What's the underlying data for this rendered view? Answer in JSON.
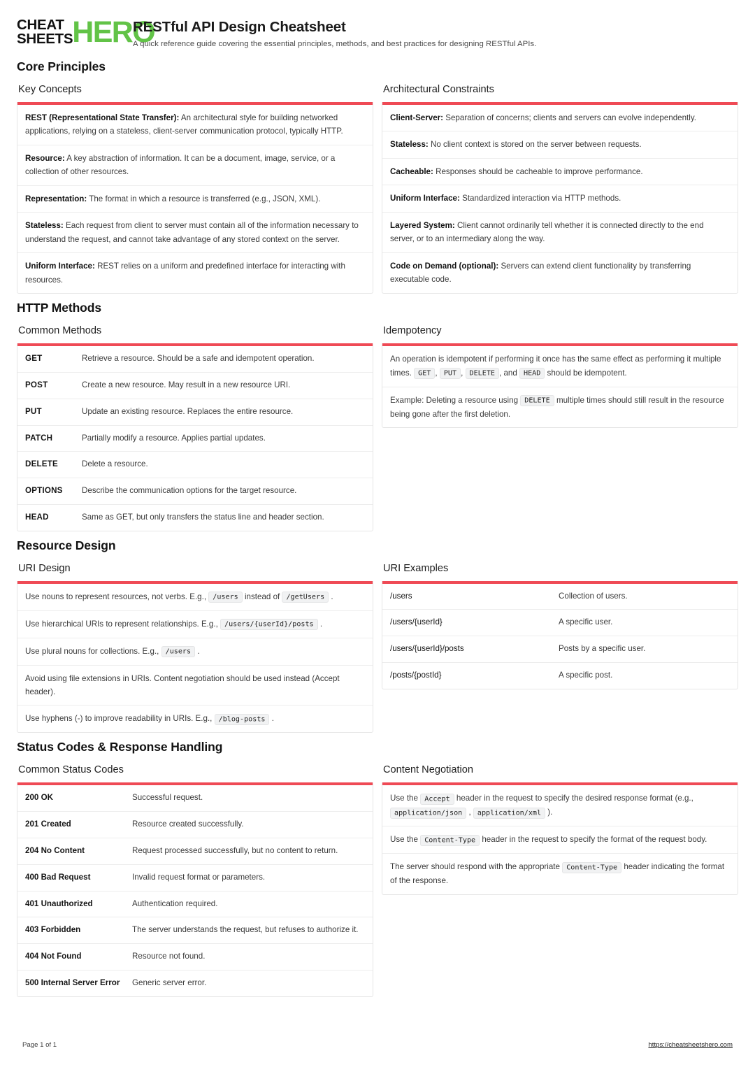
{
  "brand": {
    "line1": "CHEAT",
    "line2": "SHEETS",
    "hero": "HERO",
    "hero_color": "#62c347"
  },
  "header": {
    "title": "RESTful API Design Cheatsheet",
    "subtitle": "A quick reference guide covering the essential principles, methods, and best practices for designing RESTful APIs."
  },
  "accent_color": "#ef4a55",
  "sections": [
    {
      "title": "Core Principles"
    },
    {
      "title": "HTTP Methods"
    },
    {
      "title": "Resource Design"
    },
    {
      "title": "Status Codes & Response Handling"
    }
  ],
  "cards": {
    "key_concepts": {
      "title": "Key Concepts",
      "rows": [
        {
          "lead": "REST (Representational State Transfer):",
          "text": " An architectural style for building networked applications, relying on a stateless, client-server communication protocol, typically HTTP."
        },
        {
          "lead": "Resource:",
          "text": " A key abstraction of information. It can be a document, image, service, or a collection of other resources."
        },
        {
          "lead": "Representation:",
          "text": " The format in which a resource is transferred (e.g., JSON, XML)."
        },
        {
          "lead": "Stateless:",
          "text": " Each request from client to server must contain all of the information necessary to understand the request, and cannot take advantage of any stored context on the server."
        },
        {
          "lead": "Uniform Interface:",
          "text": " REST relies on a uniform and predefined interface for interacting with resources."
        }
      ]
    },
    "architectural_constraints": {
      "title": "Architectural Constraints",
      "rows": [
        {
          "lead": "Client-Server:",
          "text": " Separation of concerns; clients and servers can evolve independently."
        },
        {
          "lead": "Stateless:",
          "text": " No client context is stored on the server between requests."
        },
        {
          "lead": "Cacheable:",
          "text": " Responses should be cacheable to improve performance."
        },
        {
          "lead": "Uniform Interface:",
          "text": " Standardized interaction via HTTP methods."
        },
        {
          "lead": "Layered System:",
          "text": " Client cannot ordinarily tell whether it is connected directly to the end server, or to an intermediary along the way."
        },
        {
          "lead": "Code on Demand (optional):",
          "text": " Servers can extend client functionality by transferring executable code."
        }
      ]
    },
    "common_methods": {
      "title": "Common Methods",
      "rows": [
        {
          "method": "GET",
          "desc": "Retrieve a resource. Should be a safe and idempotent operation."
        },
        {
          "method": "POST",
          "desc": "Create a new resource. May result in a new resource URI."
        },
        {
          "method": "PUT",
          "desc": "Update an existing resource. Replaces the entire resource."
        },
        {
          "method": "PATCH",
          "desc": "Partially modify a resource. Applies partial updates."
        },
        {
          "method": "DELETE",
          "desc": "Delete a resource."
        },
        {
          "method": "OPTIONS",
          "desc": "Describe the communication options for the target resource."
        },
        {
          "method": "HEAD",
          "desc": "Same as GET, but only transfers the status line and header section."
        }
      ]
    },
    "idempotency": {
      "title": "Idempotency",
      "rows": [
        {
          "parts": [
            {
              "t": "text",
              "v": "An operation is idempotent if performing it once has the same effect as performing it multiple times. "
            },
            {
              "t": "code",
              "v": "GET"
            },
            {
              "t": "text",
              "v": ", "
            },
            {
              "t": "code",
              "v": "PUT"
            },
            {
              "t": "text",
              "v": ", "
            },
            {
              "t": "code",
              "v": "DELETE"
            },
            {
              "t": "text",
              "v": ", and "
            },
            {
              "t": "code",
              "v": "HEAD"
            },
            {
              "t": "text",
              "v": " should be idempotent."
            }
          ]
        },
        {
          "parts": [
            {
              "t": "text",
              "v": "Example: Deleting a resource using "
            },
            {
              "t": "code",
              "v": "DELETE"
            },
            {
              "t": "text",
              "v": " multiple times should still result in the resource being gone after the first deletion."
            }
          ]
        }
      ]
    },
    "uri_design": {
      "title": "URI Design",
      "rows": [
        {
          "parts": [
            {
              "t": "text",
              "v": "Use nouns to represent resources, not verbs. E.g., "
            },
            {
              "t": "code",
              "v": "/users"
            },
            {
              "t": "text",
              "v": " instead of "
            },
            {
              "t": "code",
              "v": "/getUsers"
            },
            {
              "t": "text",
              "v": " ."
            }
          ]
        },
        {
          "parts": [
            {
              "t": "text",
              "v": "Use hierarchical URIs to represent relationships. E.g., "
            },
            {
              "t": "code",
              "v": "/users/{userId}/posts"
            },
            {
              "t": "text",
              "v": " ."
            }
          ]
        },
        {
          "parts": [
            {
              "t": "text",
              "v": "Use plural nouns for collections. E.g., "
            },
            {
              "t": "code",
              "v": "/users"
            },
            {
              "t": "text",
              "v": " ."
            }
          ]
        },
        {
          "parts": [
            {
              "t": "text",
              "v": "Avoid using file extensions in URIs. Content negotiation should be used instead (Accept header)."
            }
          ]
        },
        {
          "parts": [
            {
              "t": "text",
              "v": "Use hyphens (-) to improve readability in URIs. E.g., "
            },
            {
              "t": "code",
              "v": "/blog-posts"
            },
            {
              "t": "text",
              "v": " ."
            }
          ]
        }
      ]
    },
    "uri_examples": {
      "title": "URI Examples",
      "rows": [
        {
          "uri": "/users",
          "desc": "Collection of users."
        },
        {
          "uri": "/users/{userId}",
          "desc": "A specific user."
        },
        {
          "uri": "/users/{userId}/posts",
          "desc": "Posts by a specific user."
        },
        {
          "uri": "/posts/{postId}",
          "desc": "A specific post."
        }
      ]
    },
    "common_status_codes": {
      "title": "Common Status Codes",
      "rows": [
        {
          "code": "200 OK",
          "desc": "Successful request."
        },
        {
          "code": "201 Created",
          "desc": "Resource created successfully."
        },
        {
          "code": "204 No Content",
          "desc": "Request processed successfully, but no content to return."
        },
        {
          "code": "400 Bad Request",
          "desc": "Invalid request format or parameters."
        },
        {
          "code": "401 Unauthorized",
          "desc": "Authentication required."
        },
        {
          "code": "403 Forbidden",
          "desc": "The server understands the request, but refuses to authorize it."
        },
        {
          "code": "404 Not Found",
          "desc": "Resource not found."
        },
        {
          "code": "500 Internal Server Error",
          "desc": "Generic server error."
        }
      ]
    },
    "content_negotiation": {
      "title": "Content Negotiation",
      "rows": [
        {
          "parts": [
            {
              "t": "text",
              "v": "Use the "
            },
            {
              "t": "code",
              "v": "Accept"
            },
            {
              "t": "text",
              "v": " header in the request to specify the desired response format (e.g., "
            },
            {
              "t": "code",
              "v": "application/json"
            },
            {
              "t": "text",
              "v": " , "
            },
            {
              "t": "code",
              "v": "application/xml"
            },
            {
              "t": "text",
              "v": " )."
            }
          ]
        },
        {
          "parts": [
            {
              "t": "text",
              "v": "Use the "
            },
            {
              "t": "code",
              "v": "Content-Type"
            },
            {
              "t": "text",
              "v": " header in the request to specify the format of the request body."
            }
          ]
        },
        {
          "parts": [
            {
              "t": "text",
              "v": "The server should respond with the appropriate "
            },
            {
              "t": "code",
              "v": "Content-Type"
            },
            {
              "t": "text",
              "v": " header indicating the format of the response."
            }
          ]
        }
      ]
    }
  },
  "footer": {
    "page": "Page 1 of 1",
    "url": "https://cheatsheetshero.com"
  }
}
